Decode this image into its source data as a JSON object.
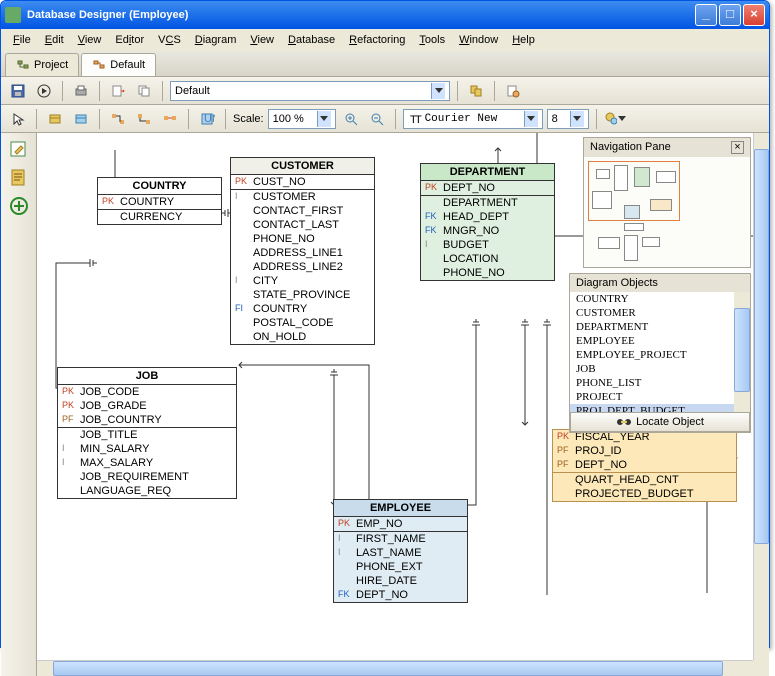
{
  "window": {
    "title": "Database Designer (Employee)"
  },
  "menu": [
    "File",
    "Edit",
    "View",
    "Editor",
    "VCS",
    "Diagram",
    "View",
    "Database",
    "Refactoring",
    "Tools",
    "Window",
    "Help"
  ],
  "menu_accel": [
    "F",
    "E",
    "V",
    "i",
    "C",
    "D",
    "V",
    "D",
    "R",
    "T",
    "W",
    "H"
  ],
  "tabs": {
    "project": "Project",
    "default": "Default"
  },
  "toolbar1": {
    "combo1": "Default"
  },
  "toolbar2": {
    "scale_label": "Scale:",
    "scale_value": "100 %",
    "font_name": "Courier New",
    "font_size": "8"
  },
  "navpane": {
    "title": "Navigation Pane"
  },
  "objpane": {
    "title": "Diagram Objects",
    "items": [
      "COUNTRY",
      "CUSTOMER",
      "DEPARTMENT",
      "EMPLOYEE",
      "EMPLOYEE_PROJECT",
      "JOB",
      "PHONE_LIST",
      "PROJECT",
      "PROJ_DEPT_BUDGET"
    ],
    "button": "Locate Object"
  },
  "entities": {
    "country": {
      "title": "COUNTRY",
      "rows1": [
        [
          "PK",
          "COUNTRY"
        ]
      ],
      "rows2": [
        [
          "",
          "CURRENCY"
        ]
      ]
    },
    "customer": {
      "title": "CUSTOMER",
      "rows1": [
        [
          "PK",
          "CUST_NO"
        ]
      ],
      "rows2": [
        [
          "I",
          "CUSTOMER"
        ],
        [
          "",
          "CONTACT_FIRST"
        ],
        [
          "",
          "CONTACT_LAST"
        ],
        [
          "",
          "PHONE_NO"
        ],
        [
          "",
          "ADDRESS_LINE1"
        ],
        [
          "",
          "ADDRESS_LINE2"
        ],
        [
          "I",
          "CITY"
        ],
        [
          "",
          "STATE_PROVINCE"
        ],
        [
          "FI",
          "COUNTRY"
        ],
        [
          "",
          "POSTAL_CODE"
        ],
        [
          "",
          "ON_HOLD"
        ]
      ]
    },
    "department": {
      "title": "DEPARTMENT",
      "rows1": [
        [
          "PK",
          "DEPT_NO"
        ]
      ],
      "rows2": [
        [
          "",
          "DEPARTMENT"
        ],
        [
          "FK",
          "HEAD_DEPT"
        ],
        [
          "FK",
          "MNGR_NO"
        ],
        [
          "I",
          "BUDGET"
        ],
        [
          "",
          "LOCATION"
        ],
        [
          "",
          "PHONE_NO"
        ]
      ]
    },
    "job": {
      "title": "JOB",
      "rows1": [
        [
          "PK",
          "JOB_CODE"
        ],
        [
          "PK",
          "JOB_GRADE"
        ],
        [
          "PF",
          "JOB_COUNTRY"
        ]
      ],
      "rows2": [
        [
          "",
          "JOB_TITLE"
        ],
        [
          "I",
          "MIN_SALARY"
        ],
        [
          "I",
          "MAX_SALARY"
        ],
        [
          "",
          "JOB_REQUIREMENT"
        ],
        [
          "",
          "LANGUAGE_REQ"
        ]
      ]
    },
    "employee": {
      "title": "EMPLOYEE",
      "rows1": [
        [
          "PK",
          "EMP_NO"
        ]
      ],
      "rows2": [
        [
          "I",
          "FIRST_NAME"
        ],
        [
          "I",
          "LAST_NAME"
        ],
        [
          "",
          "PHONE_EXT"
        ],
        [
          "",
          "HIRE_DATE"
        ],
        [
          "FK",
          "DEPT_NO"
        ]
      ]
    },
    "budget": {
      "rows1": [
        [
          "PK",
          "FISCAL_YEAR"
        ],
        [
          "PF",
          "PROJ_ID"
        ],
        [
          "PF",
          "DEPT_NO"
        ]
      ],
      "rows2": [
        [
          "",
          "QUART_HEAD_CNT"
        ],
        [
          "",
          "PROJECTED_BUDGET"
        ]
      ]
    }
  }
}
